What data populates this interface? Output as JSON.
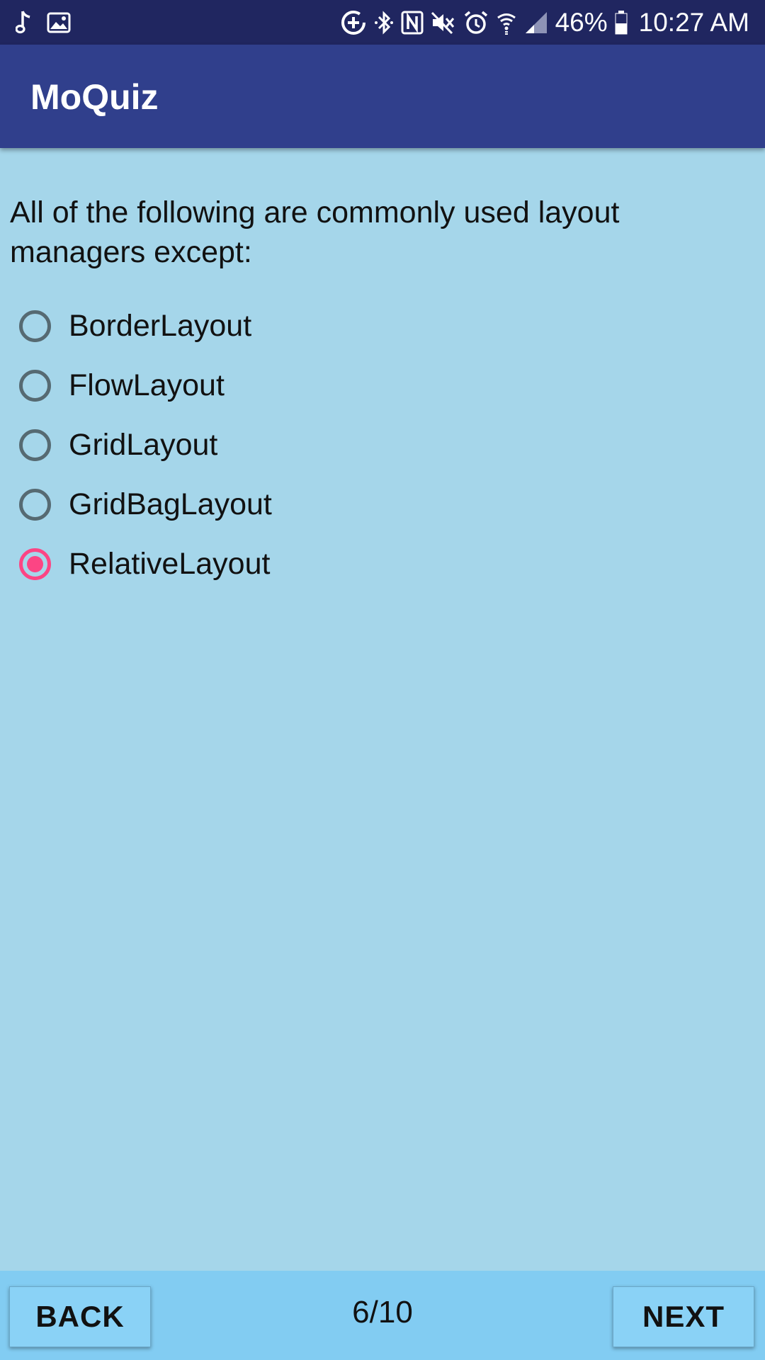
{
  "status_bar": {
    "left_icons": [
      "music-note-icon",
      "image-icon"
    ],
    "right_icons": [
      "data-saver-icon",
      "bluetooth-icon",
      "nfc-icon",
      "mute-icon",
      "alarm-icon",
      "wifi-icon",
      "signal-icon",
      "battery-icon"
    ],
    "battery": "46%",
    "time": "10:27 AM",
    "background": "#202660"
  },
  "app_bar": {
    "title": "MoQuiz",
    "background": "#303f8c"
  },
  "quiz": {
    "question": "All of the following are commonly used layout managers except:",
    "options": [
      {
        "label": "BorderLayout",
        "selected": false
      },
      {
        "label": "FlowLayout",
        "selected": false
      },
      {
        "label": "GridLayout",
        "selected": false
      },
      {
        "label": "GridBagLayout",
        "selected": false
      },
      {
        "label": "RelativeLayout",
        "selected": true
      }
    ],
    "selected_color": "#fc4584",
    "background": "#a5d6ea"
  },
  "footer": {
    "back_label": "BACK",
    "next_label": "NEXT",
    "progress": "6/10",
    "background": "#82ccf2"
  }
}
